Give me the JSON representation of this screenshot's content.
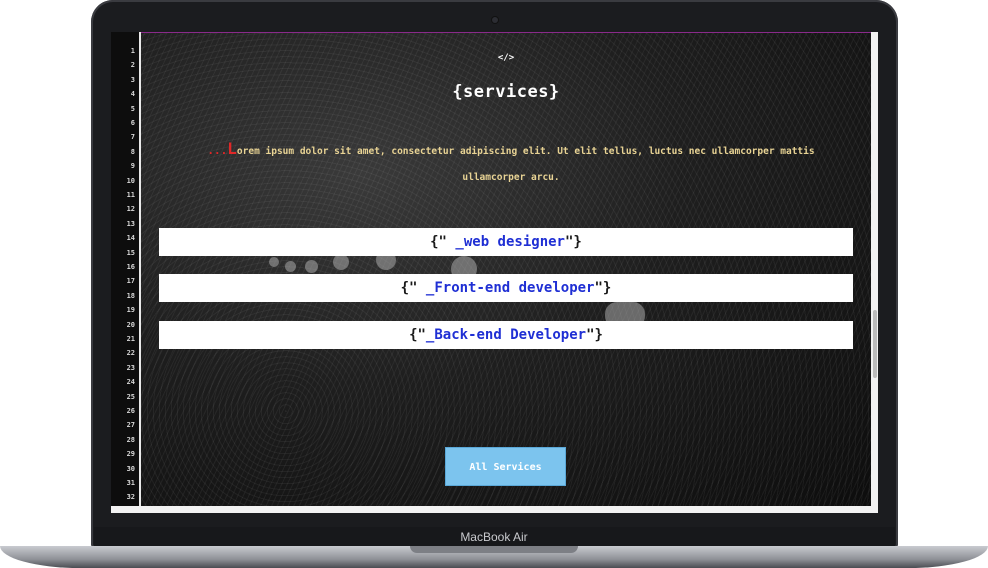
{
  "device": {
    "brand": "MacBook Air"
  },
  "gutter": {
    "line_numbers": [
      "1",
      "2",
      "3",
      "4",
      "5",
      "6",
      "7",
      "8",
      "9",
      "10",
      "11",
      "12",
      "13",
      "14",
      "15",
      "16",
      "17",
      "18",
      "19",
      "20",
      "21",
      "22",
      "23",
      "24",
      "25",
      "26",
      "27",
      "28",
      "29",
      "30",
      "31",
      "32"
    ]
  },
  "header": {
    "icon_glyph": "</>",
    "title": "{services}"
  },
  "intro": {
    "prefix": "...",
    "first_letter": "L",
    "text": "orem ipsum dolor sit amet, consectetur adipiscing elit. Ut elit tellus, luctus nec ullamcorper mattis ullamcorper arcu."
  },
  "services": [
    {
      "open": "{\"",
      "label": " _web designer",
      "close": "\"}"
    },
    {
      "open": "{\"",
      "label": " _Front-end developer",
      "close": "\"}"
    },
    {
      "open": "{\"",
      "label": "_Back-end Developer",
      "close": "\"}"
    }
  ],
  "cta": {
    "label": "All Services"
  },
  "colors": {
    "accent": "#7cc4ee",
    "service_text": "#1f2fd4",
    "intro_text": "#e8d394",
    "highlight": "#e02828"
  }
}
